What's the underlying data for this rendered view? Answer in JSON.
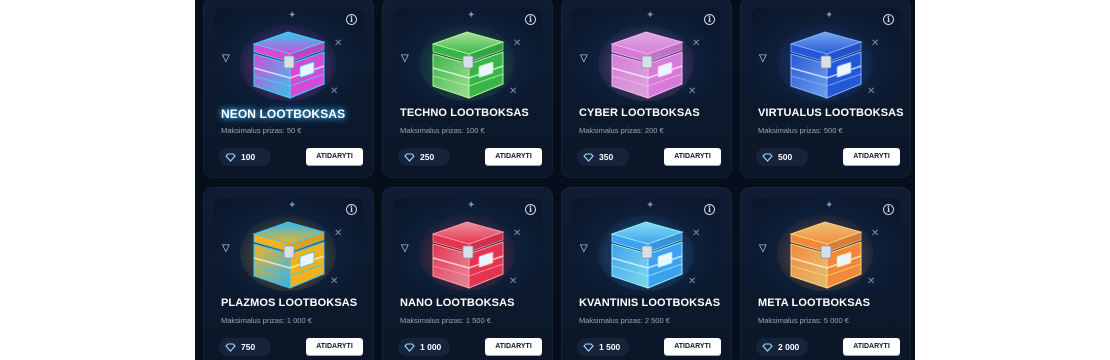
{
  "button_label": "ATIDARYTI",
  "cards": [
    {
      "title": "NEON LOOTBOKSAS",
      "subtitle": "Maksimalus prizas: 50 €",
      "price": "100",
      "color": "#d34ad6",
      "color2": "#3bd7ff",
      "glow": true
    },
    {
      "title": "TECHNO LOOTBOKSAS",
      "subtitle": "Maksimalus prizas: 100 €",
      "price": "250",
      "color": "#39b548",
      "color2": "#b7f5a1",
      "glow": false
    },
    {
      "title": "CYBER LOOTBOKSAS",
      "subtitle": "Maksimalus prizas: 200 €",
      "price": "350",
      "color": "#d77ad8",
      "color2": "#f3b8ee",
      "glow": false
    },
    {
      "title": "VIRTUALUS LOOTBOKSAS",
      "subtitle": "Maksimalus prizas: 500 €",
      "price": "500",
      "color": "#2557d9",
      "color2": "#7fb3ff",
      "glow": false
    },
    {
      "title": "PLAZMOS LOOTBOKSAS",
      "subtitle": "Maksimalus prizas: 1 000 €",
      "price": "750",
      "color": "#f2b21e",
      "color2": "#36c6ff",
      "glow": false
    },
    {
      "title": "NANO LOOTBOKSAS",
      "subtitle": "Maksimalus prizas: 1 500 €",
      "price": "1 000",
      "color": "#e5344f",
      "color2": "#ff9aa8",
      "glow": false
    },
    {
      "title": "KVANTINIS LOOTBOKSAS",
      "subtitle": "Maksimalus prizas: 2 500 €",
      "price": "1 500",
      "color": "#3fa0f0",
      "color2": "#8ef0ff",
      "glow": false
    },
    {
      "title": "META LOOTBOKSAS",
      "subtitle": "Maksimalus prizas: 5 000 €",
      "price": "2 000",
      "color": "#f08a3a",
      "color2": "#ffd27a",
      "glow": false
    }
  ]
}
